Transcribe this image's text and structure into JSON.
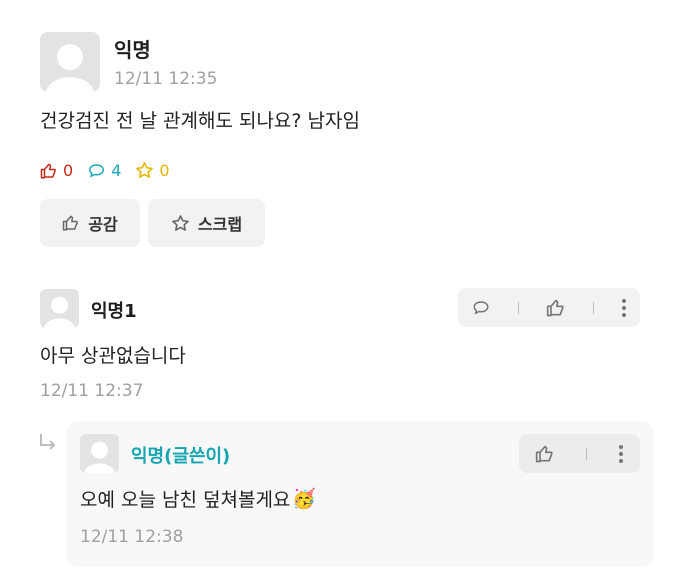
{
  "post": {
    "author": "익명",
    "time": "12/11 12:35",
    "body": "건강검진 전 날 관계해도 되나요? 남자임",
    "likes": "0",
    "comments": "4",
    "scraps": "0",
    "like_button": "공감",
    "scrap_button": "스크랩"
  },
  "comment": {
    "author": "익명1",
    "body": "아무 상관없습니다",
    "time": "12/11 12:37"
  },
  "reply": {
    "author": "익명(글쓴이)",
    "body": "오예 오늘 남친 덮쳐볼게요",
    "emoji": "🥳",
    "time": "12/11 12:38"
  },
  "icons": [
    "thumbs-up-icon",
    "speech-bubble-icon",
    "star-icon",
    "more-vertical-icon",
    "reply-arrow-icon",
    "avatar-icon"
  ],
  "colors": {
    "like_red": "#c62917",
    "comment_teal": "#1aa9b8",
    "scrap_gold": "#e7b400",
    "op_teal": "#15a6b0"
  }
}
